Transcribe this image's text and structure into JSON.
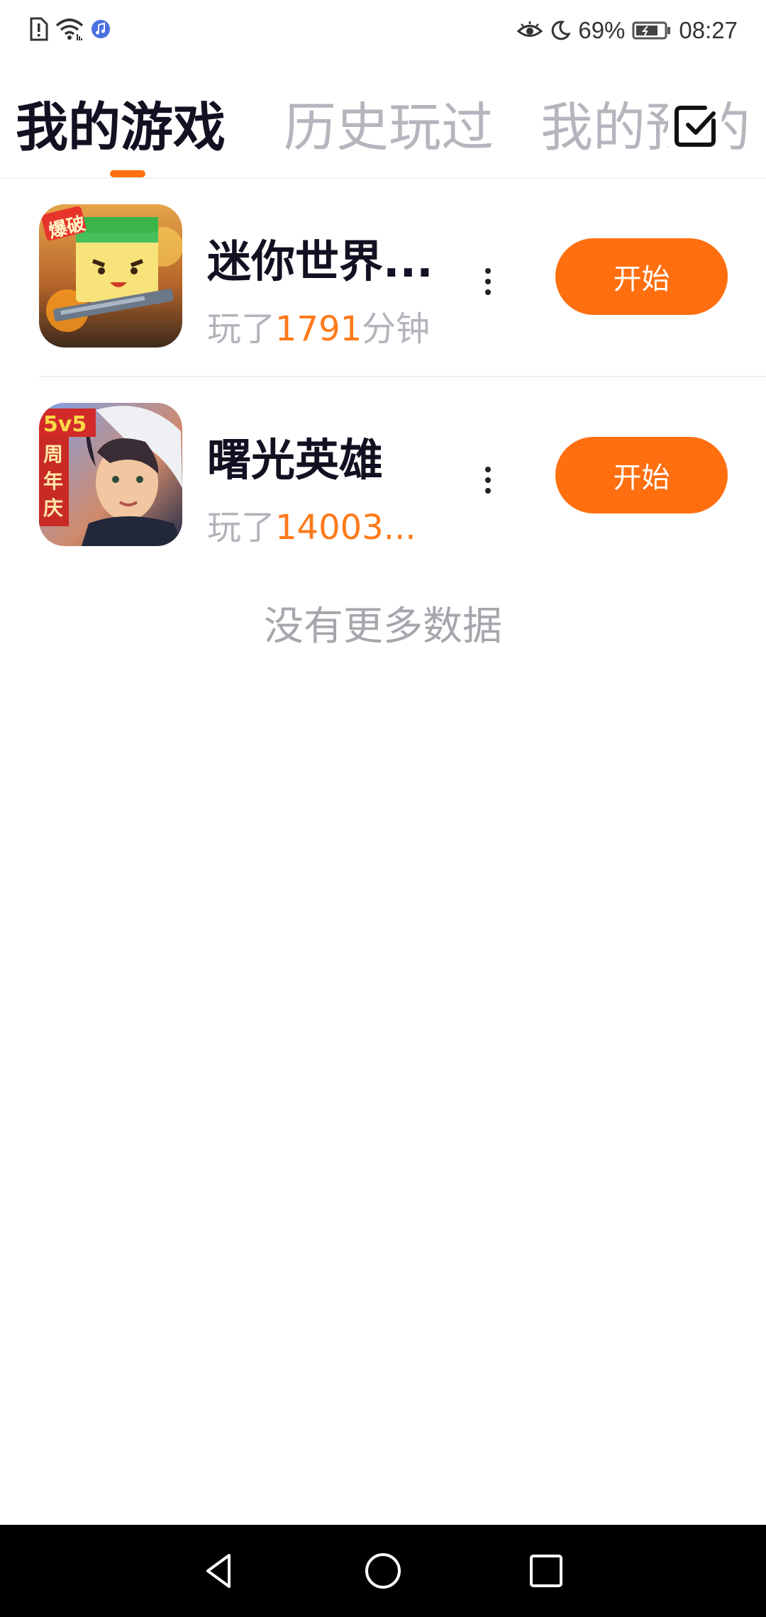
{
  "status_bar": {
    "battery": "69%",
    "time": "08:27"
  },
  "tabs": [
    {
      "label": "我的游戏",
      "active": true
    },
    {
      "label": "历史玩过",
      "active": false
    },
    {
      "label": "我的预约",
      "active": false
    }
  ],
  "games": [
    {
      "title": "迷你世界...",
      "played_prefix": "玩了",
      "played_value": "1791",
      "played_suffix": "分钟",
      "button": "开始",
      "icon_badge": "爆破"
    },
    {
      "title": "曙光英雄",
      "played_prefix": "玩了",
      "played_value": "14003...",
      "played_suffix": "",
      "button": "开始",
      "icon_badge_top": "5v5",
      "icon_badge_side": "周年庆"
    }
  ],
  "footer_text": "没有更多数据",
  "colors": {
    "accent": "#ff6f0f",
    "title": "#111122",
    "muted": "#b3b3bb"
  }
}
